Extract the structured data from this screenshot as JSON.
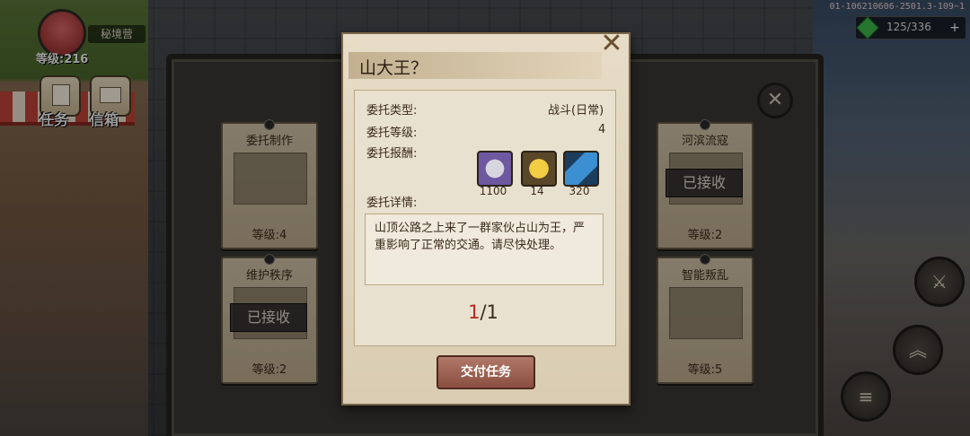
{
  "hud": {
    "level": "等级:216",
    "area_name": "秘境营",
    "debug_text": "01-106210606-2501.3-109~1",
    "gems": "125/336",
    "task_label": "任务",
    "mail_label": "信箱"
  },
  "board": {
    "cards": [
      {
        "title": "委托制作",
        "level": "等级:4",
        "stamp": ""
      },
      {
        "title": "河滨流寇",
        "level": "等级:2",
        "stamp": "已接收"
      },
      {
        "title": "维护秩序",
        "level": "等级:2",
        "stamp": "已接收"
      },
      {
        "title": "智能叛乱",
        "level": "等级:5",
        "stamp": ""
      }
    ]
  },
  "modal": {
    "title": "山大王？",
    "type_label": "委托类型:",
    "type_value": "战斗(日常)",
    "level_label": "委托等级:",
    "level_value": "4",
    "reward_label": "委托报酬:",
    "rewards": [
      {
        "icon": "silver-coin-icon",
        "amount": "1100"
      },
      {
        "icon": "gold-coin-icon",
        "amount": "14"
      },
      {
        "icon": "blue-card-icon",
        "amount": "320"
      }
    ],
    "detail_label": "委托详情:",
    "detail_text": "山顶公路之上来了一群家伙占山为王，严重影响了正常的交通。请尽快处理。",
    "page_current": "1",
    "page_total": "/1",
    "submit_label": "交付任务"
  }
}
